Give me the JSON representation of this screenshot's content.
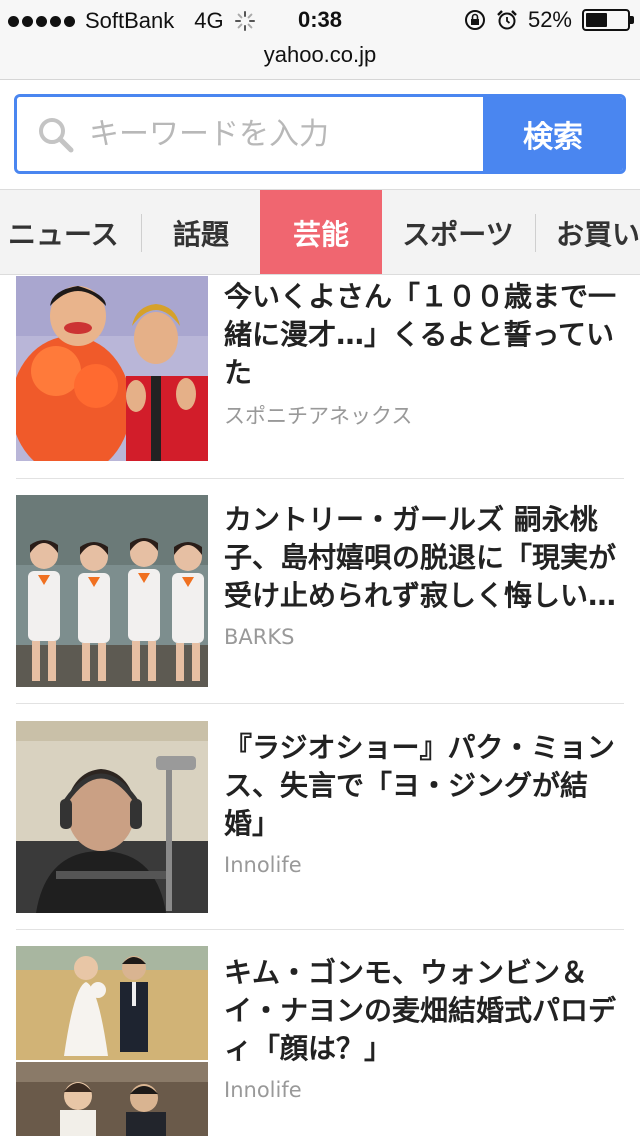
{
  "status_bar": {
    "carrier": "SoftBank",
    "network": "4G",
    "time": "0:38",
    "battery_percent": "52%",
    "battery_level": 0.52
  },
  "url_bar": {
    "url": "yahoo.co.jp"
  },
  "search": {
    "placeholder": "キーワードを入力",
    "button_label": "検索",
    "accent_color": "#4a86f0"
  },
  "tabs": [
    {
      "label": "ニュース",
      "active": false
    },
    {
      "label": "話題",
      "active": false
    },
    {
      "label": "芸能",
      "active": true
    },
    {
      "label": "スポーツ",
      "active": false
    },
    {
      "label": "お買い",
      "active": false
    }
  ],
  "active_tab_color": "#f06670",
  "articles": [
    {
      "title": "今いくよさん「１００歳まで一緒に漫才…」くるよと誓っていた",
      "source": "スポニチアネックス"
    },
    {
      "title": "カントリー・ガールズ 嗣永桃子、島村嬉唄の脱退に「現実が受け止められず寂しく悔しい…",
      "source": "BARKS"
    },
    {
      "title": "『ラジオショー』パク・ミョンス、失言で「ヨ・ジングが結婚」",
      "source": "Innolife"
    },
    {
      "title": "キム・ゴンモ、ウォンビン＆イ・ナヨンの麦畑結婚式パロディ「顔は？」",
      "source": "Innolife"
    }
  ]
}
